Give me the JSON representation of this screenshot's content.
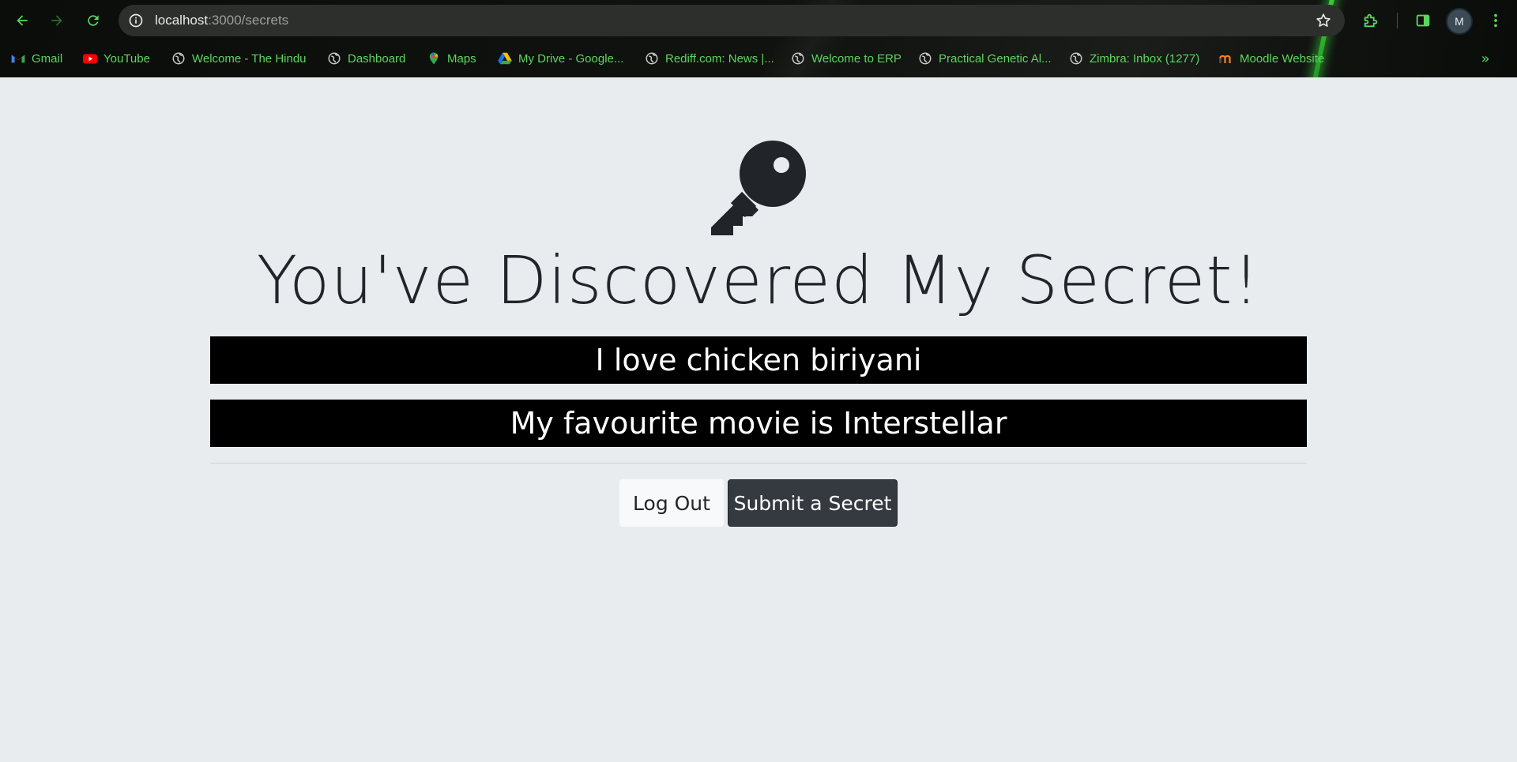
{
  "browser": {
    "url_host": "localhost",
    "url_path": ":3000/secrets",
    "profile_initial": "M",
    "accent_color": "#5ed55e",
    "bookmarks": [
      {
        "label": "Gmail",
        "icon": "gmail-icon"
      },
      {
        "label": "YouTube",
        "icon": "youtube-icon"
      },
      {
        "label": "Welcome - The Hindu",
        "icon": "globe-icon"
      },
      {
        "label": "Dashboard",
        "icon": "globe-icon"
      },
      {
        "label": "Maps",
        "icon": "maps-pin-icon"
      },
      {
        "label": "My Drive - Google...",
        "icon": "google-drive-icon"
      },
      {
        "label": "Rediff.com: News |...",
        "icon": "globe-icon"
      },
      {
        "label": "Welcome to ERP",
        "icon": "globe-icon"
      },
      {
        "label": "Practical Genetic Al...",
        "icon": "globe-icon"
      },
      {
        "label": "Zimbra: Inbox (1277)",
        "icon": "globe-icon"
      },
      {
        "label": "Moodle Website",
        "icon": "moodle-icon"
      }
    ]
  },
  "page": {
    "icon": "key-icon",
    "title": "You've Discovered My Secret!",
    "secrets": [
      "I love chicken biriyani",
      "My favourite movie is Interstellar"
    ],
    "logout_label": "Log Out",
    "submit_label": "Submit a Secret"
  }
}
